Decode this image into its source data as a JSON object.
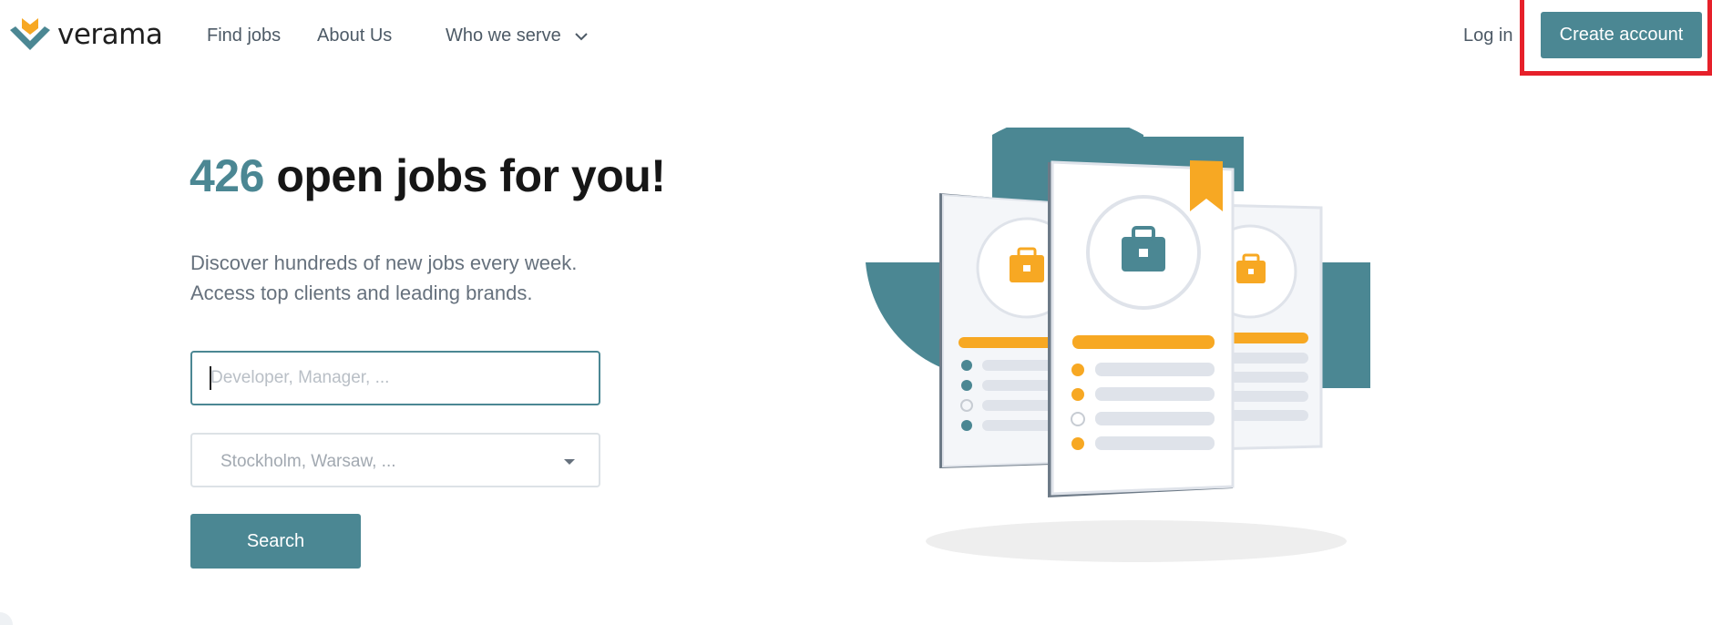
{
  "brand": {
    "name": "verama",
    "colors": {
      "accent": "#4b8793",
      "orange": "#f7a823",
      "highlight": "#e6202a"
    }
  },
  "nav": {
    "find_jobs": "Find jobs",
    "about_us": "About Us",
    "who_we_serve": "Who we serve",
    "log_in": "Log in",
    "create_account": "Create account"
  },
  "hero": {
    "count": "426",
    "title_rest": "open jobs for you!",
    "subtitle_line1": "Discover hundreds of new jobs every week.",
    "subtitle_line2": "Access top clients and leading brands."
  },
  "search": {
    "job_placeholder": "Developer, Manager, ...",
    "job_value": "",
    "location_placeholder": "Stockholm, Warsaw, ...",
    "button_label": "Search"
  },
  "icons": [
    "verama-logo-icon",
    "chevron-down-icon",
    "dropdown-arrow-icon",
    "briefcase-icon",
    "bookmark-icon"
  ]
}
